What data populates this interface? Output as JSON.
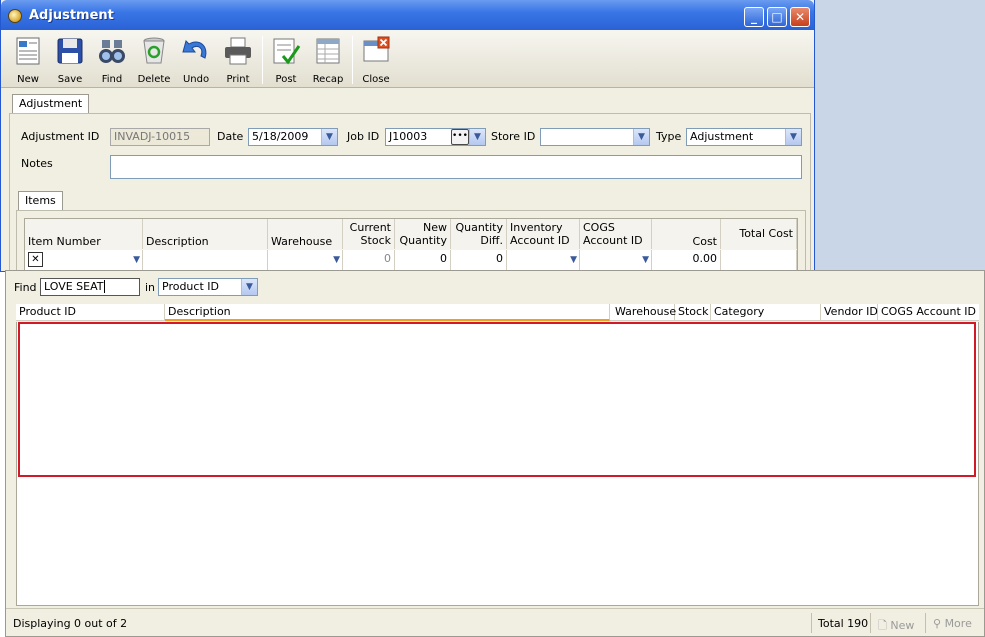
{
  "window": {
    "title": "Adjustment"
  },
  "toolbar": [
    {
      "label": "New",
      "icon": "new-document-icon"
    },
    {
      "label": "Save",
      "icon": "floppy-disk-icon"
    },
    {
      "label": "Find",
      "icon": "binoculars-icon"
    },
    {
      "label": "Delete",
      "icon": "recycle-bin-icon"
    },
    {
      "label": "Undo",
      "icon": "undo-arrow-icon"
    },
    {
      "label": "Print",
      "icon": "printer-icon"
    },
    {
      "label": "Post",
      "icon": "post-checklist-icon"
    },
    {
      "label": "Recap",
      "icon": "recap-sheet-icon"
    },
    {
      "label": "Close",
      "icon": "close-window-icon"
    }
  ],
  "main_tab": "Adjustment",
  "form": {
    "adjustment_id_label": "Adjustment ID",
    "adjustment_id": "INVADJ-10015",
    "date_label": "Date",
    "date": "5/18/2009",
    "job_id_label": "Job ID",
    "job_id": "J10003",
    "store_id_label": "Store ID",
    "store_id": "",
    "type_label": "Type",
    "type": "Adjustment",
    "notes_label": "Notes",
    "notes": ""
  },
  "items_tab": "Items",
  "items_grid": {
    "columns": [
      {
        "l1": "",
        "l2": "Item Number"
      },
      {
        "l1": "",
        "l2": "Description"
      },
      {
        "l1": "",
        "l2": "Warehouse"
      },
      {
        "l1": "Current",
        "l2": "Stock"
      },
      {
        "l1": "New",
        "l2": "Quantity"
      },
      {
        "l1": "Quantity",
        "l2": "Diff."
      },
      {
        "l1": "Inventory",
        "l2": "Account ID"
      },
      {
        "l1": "COGS",
        "l2": "Account ID"
      },
      {
        "l1": "",
        "l2": "Cost"
      },
      {
        "l1": "Total Cost",
        "l2": ""
      }
    ],
    "row": {
      "current_stock": "0",
      "new_quantity": "0",
      "quantity_diff": "0",
      "cost": "0.00"
    }
  },
  "lookup": {
    "find_label": "Find",
    "find_value": "LOVE SEAT",
    "in_label": "in",
    "in_value": "Product ID",
    "columns": [
      "Product ID",
      "Description",
      "Warehouse",
      "Stock",
      "Category",
      "Vendor ID",
      "COGS Account ID"
    ],
    "sorted_column": "Description",
    "status": "Displaying 0 out of 2",
    "total": "Total 190",
    "new_label": "New",
    "more_label": "More"
  },
  "colors": {
    "highlight": "#d01a28",
    "sort_indicator": "#f0a020",
    "titlebar": "#2a62d6"
  }
}
